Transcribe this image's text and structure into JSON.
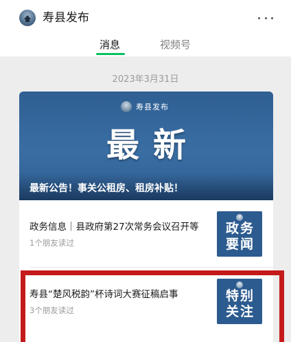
{
  "account": {
    "name": "寿县发布",
    "avatar_icon": "pagoda-avatar-icon",
    "more_icon": "more-dots-icon"
  },
  "tabs": [
    {
      "label": "消息",
      "active": true
    },
    {
      "label": "视频号",
      "active": false
    }
  ],
  "colors": {
    "accent": "#07c160",
    "cover_blue": "#2f5f93",
    "highlight": "#c41a1a"
  },
  "feed": {
    "date": "2023年3月31日",
    "cover": {
      "logo_text": "寿县发布",
      "hero_text": "最新",
      "title": "最新公告！事关公租房、租房补贴！"
    },
    "items": [
      {
        "title": "政务信息｜县政府第27次常务会议召开等",
        "reads": "1个朋友读过",
        "thumb_text": "政务\n要闻"
      },
      {
        "title": "寿县“楚风税韵”杯诗词大赛征稿启事",
        "reads": "3个朋友读过",
        "thumb_text": "特别\n关注"
      }
    ]
  }
}
